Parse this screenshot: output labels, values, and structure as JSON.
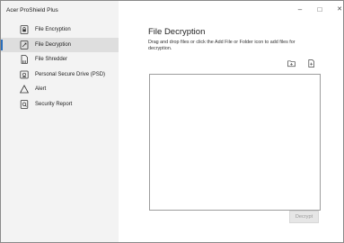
{
  "app": {
    "title": "Acer ProShield Plus"
  },
  "sidebar": {
    "items": [
      {
        "label": "File Encryption",
        "icon": "lock-document-icon"
      },
      {
        "label": "File Decryption",
        "icon": "unlock-document-icon",
        "active": true
      },
      {
        "label": "File Shredder",
        "icon": "shredder-icon"
      },
      {
        "label": "Personal Secure Drive (PSD)",
        "icon": "secure-drive-icon"
      },
      {
        "label": "Alert",
        "icon": "warning-triangle-icon"
      },
      {
        "label": "Security Report",
        "icon": "report-icon"
      }
    ]
  },
  "window_controls": {
    "minimize": "–",
    "maximize": "□",
    "close": "✕"
  },
  "main": {
    "title": "File Decryption",
    "instructions": "Drag and drop files or click the Add File or Folder icon to add files for decryption.",
    "toolbar": {
      "add_folder_icon": "add-folder-icon",
      "add_file_icon": "add-file-icon"
    },
    "decrypt_button": "Decrypt"
  },
  "colors": {
    "accent": "#2a6ebb",
    "sidebar_bg": "#f3f3f3",
    "active_item_bg": "#dedede"
  }
}
